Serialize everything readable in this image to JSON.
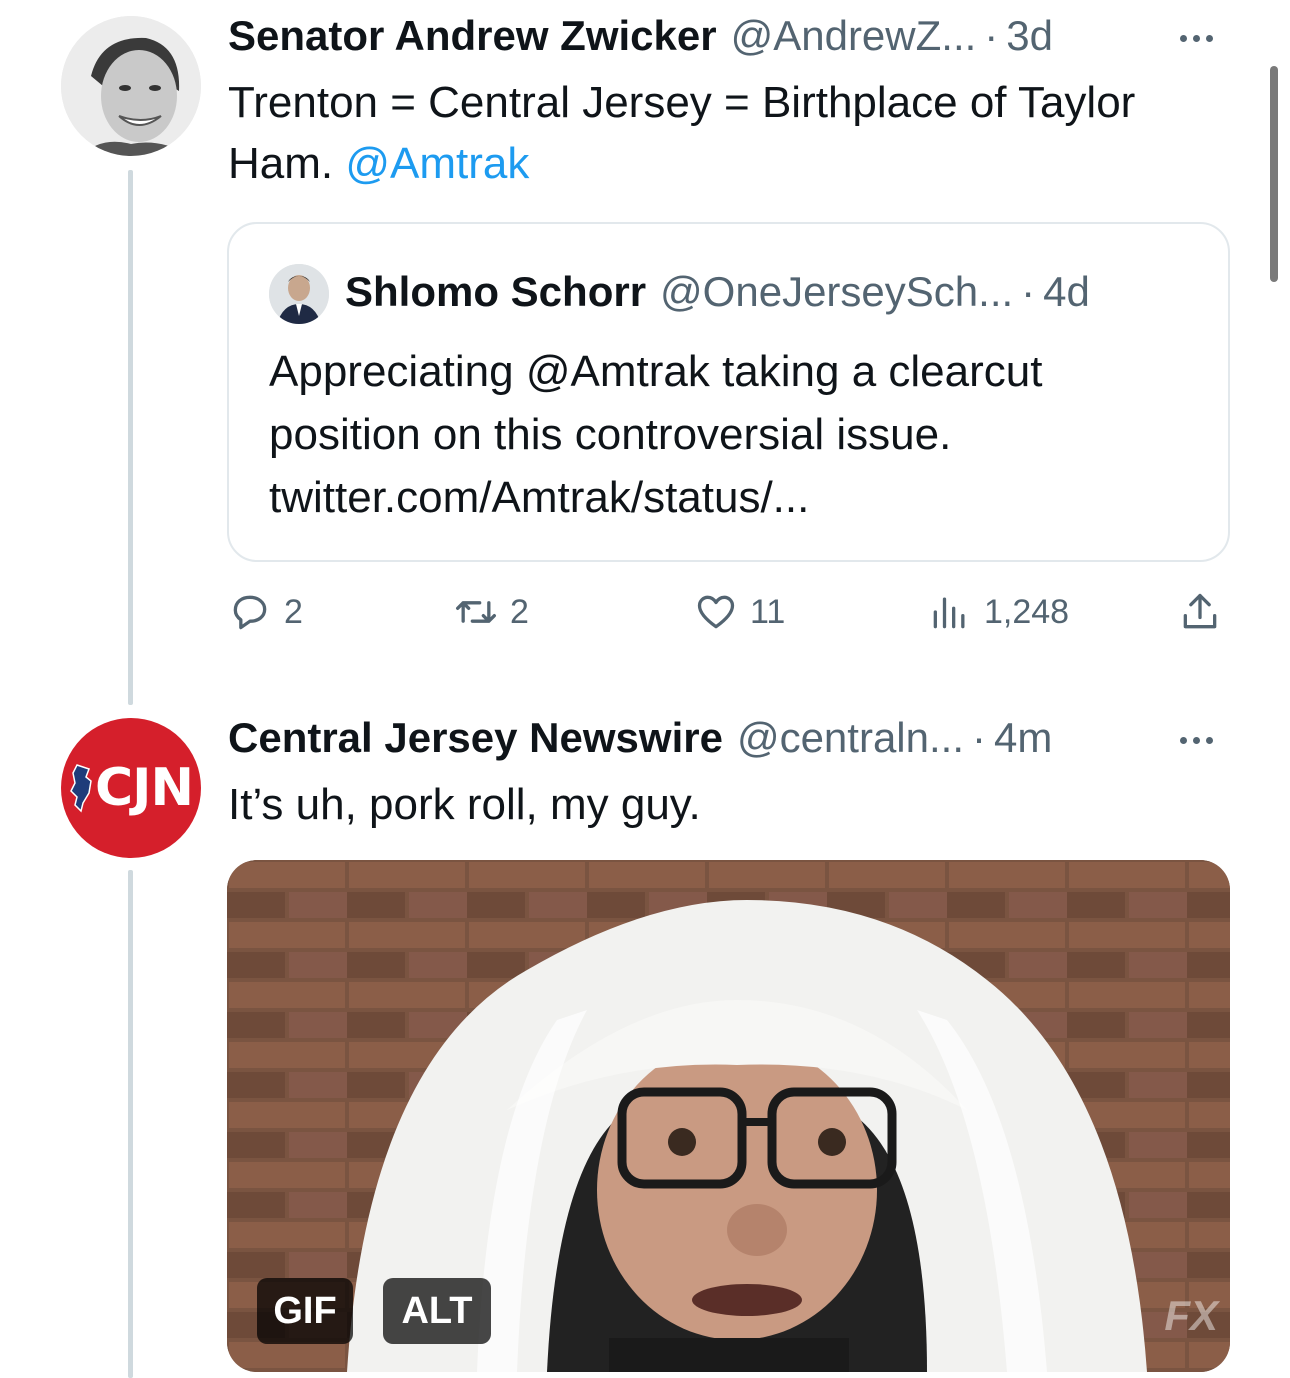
{
  "tweets": [
    {
      "display_name": "Senator Andrew Zwicker",
      "handle": "@AndrewZ...",
      "separator": "·",
      "time": "3d",
      "text_plain": "Trenton = Central Jersey = Birthplace of Taylor Ham.",
      "text_mention": "@Amtrak",
      "quote": {
        "display_name": "Shlomo Schorr",
        "handle": "@OneJerseySch...",
        "separator": "·",
        "time": "4d",
        "text": "Appreciating @Amtrak taking a clearcut position on this controversial issue. twitter.com/Amtrak/status/..."
      },
      "actions": {
        "replies": "2",
        "retweets": "2",
        "likes": "11",
        "views": "1,248"
      }
    },
    {
      "display_name": "Central Jersey Newswire",
      "handle": "@centraln...",
      "separator": "·",
      "time": "4m",
      "avatar_text": "CJN",
      "text": "It’s uh, pork roll, my guy.",
      "media": {
        "type_badge": "GIF",
        "alt_badge": "ALT",
        "watermark": "FX"
      }
    }
  ],
  "colors": {
    "link": "#1d9bf0",
    "muted": "#536471",
    "cjn_red": "#d51f2b"
  }
}
